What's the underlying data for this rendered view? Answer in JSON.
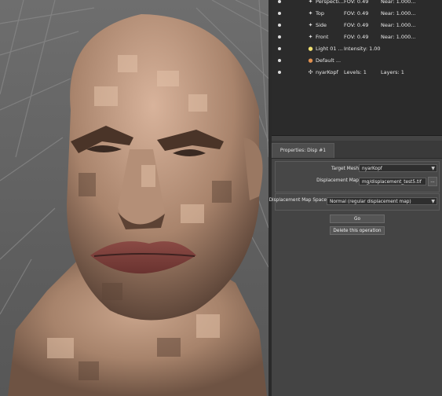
{
  "outliner": {
    "rows": [
      {
        "icon": "camera-icon",
        "name": "Perspecti...",
        "c1": "FOV: 0.49",
        "c2": "Near: 1.000..."
      },
      {
        "icon": "camera-icon",
        "name": "Top",
        "c1": "FOV: 0.49",
        "c2": "Near: 1.000..."
      },
      {
        "icon": "camera-icon",
        "name": "Side",
        "c1": "FOV: 0.49",
        "c2": "Near: 1.000..."
      },
      {
        "icon": "camera-icon",
        "name": "Front",
        "c1": "FOV: 0.49",
        "c2": "Near: 1.000..."
      },
      {
        "icon": "light-bulb-icon",
        "name": "Light 01 ...",
        "c1": "Intensity: 1.00",
        "c2": ""
      },
      {
        "icon": "material-icon",
        "name": "Default ...",
        "c1": "",
        "c2": ""
      },
      {
        "icon": "mesh-icon",
        "name": "nyarKopf",
        "c1": "Levels: 1",
        "c2": "Layers: 1"
      }
    ]
  },
  "properties": {
    "tab_label": "Properties: Disp #1",
    "target_mesh_label": "Target Mesh",
    "target_mesh_value": "nyarKopf",
    "displacement_map_label": "Displacement Map",
    "displacement_map_value": "mg/displacement_test5.tif",
    "browse_label": "...",
    "map_space_label": "Displacement Map Space",
    "map_space_value": "Normal (regular displacement map)",
    "go_label": "Go",
    "delete_label": "Delete this operation"
  },
  "colors": {
    "viewport_bg": "#636363",
    "panel_bg": "#444444",
    "outliner_bg": "#2b2b2b",
    "skin": "#b08c74"
  }
}
